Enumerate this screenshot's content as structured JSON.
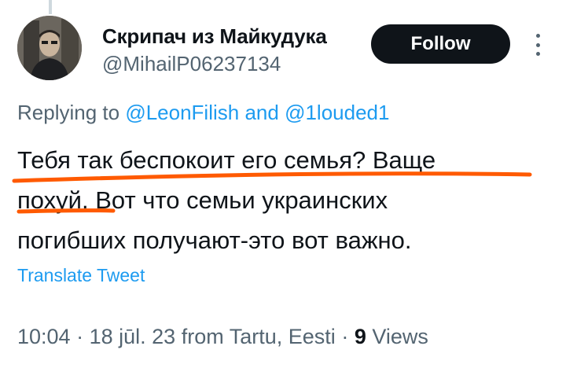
{
  "author": {
    "display_name": "Скрипач из Майкудука",
    "handle": "@MihailP06237134"
  },
  "follow_label": "Follow",
  "replying": {
    "prefix": "Replying to",
    "mention1": "@LeonFilish",
    "conjunction": "and",
    "mention2": "@1louded1"
  },
  "tweet": {
    "lines": [
      "Тебя так беспокоит его семья? Ваще",
      "похуй. Вот что семьи украинских",
      "погибших получают-это вот важно."
    ]
  },
  "translate_label": "Translate Tweet",
  "meta": {
    "time": "10:04",
    "date": "18 jūl. 23",
    "source": "from Tartu, Eesti",
    "views_count": "9",
    "views_label": "Views"
  },
  "colors": {
    "text": "#0f1419",
    "secondary": "#536471",
    "link": "#1d9bf0",
    "follow_bg": "#0f1419",
    "annotation_underline": "#ff5a00"
  }
}
